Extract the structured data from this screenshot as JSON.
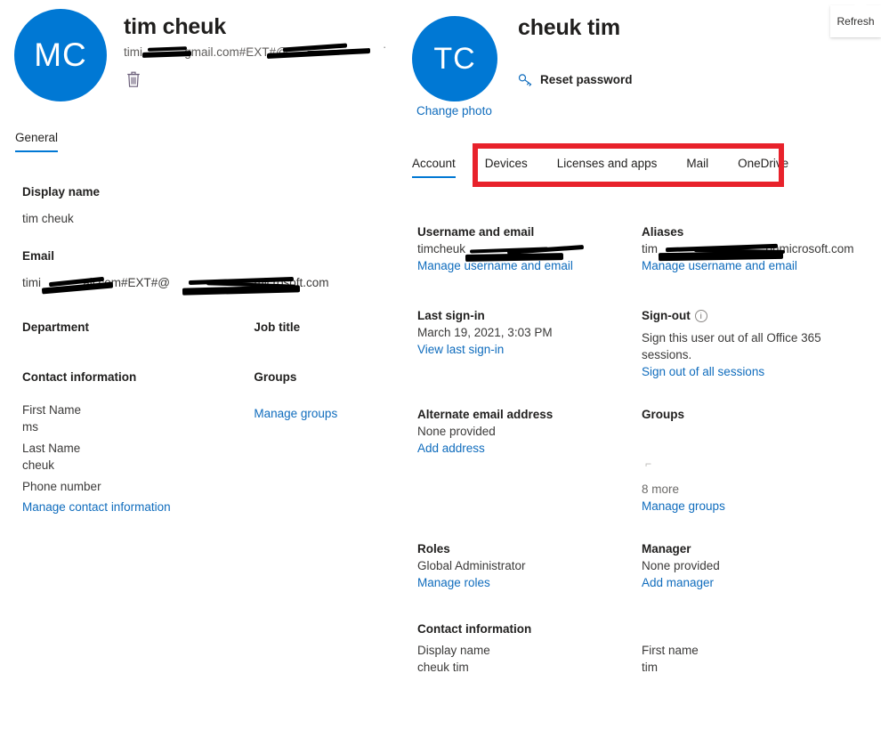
{
  "left_panel": {
    "avatar_initials": "MC",
    "avatar_color": "#0078d4",
    "display_name": "tim cheuk",
    "email_header_prefix": "timi",
    "email_header_mid": "gmail.com#EXT#@",
    "delete_icon": "trash-icon",
    "tabs": [
      {
        "label": "General",
        "selected": true
      }
    ],
    "sections": {
      "display_name": {
        "header": "Display name",
        "value": "tim cheuk"
      },
      "email": {
        "header": "Email",
        "value_prefix": "timi",
        "value_mid": "ail.com#EXT#@",
        "value_suffix": "microsoft.com"
      },
      "department": {
        "header": "Department",
        "value": ""
      },
      "job_title": {
        "header": "Job title",
        "value": ""
      },
      "contact_information": {
        "header": "Contact information",
        "fields": [
          {
            "label": "First Name",
            "value": "ms"
          },
          {
            "label": "Last Name",
            "value": "cheuk"
          },
          {
            "label": "Phone number",
            "value": ""
          }
        ],
        "link": "Manage contact information"
      },
      "groups": {
        "header": "Groups",
        "link": "Manage groups"
      }
    }
  },
  "right_panel": {
    "avatar_initials": "TC",
    "avatar_color": "#0078d4",
    "change_photo": "Change photo",
    "display_name": "cheuk tim",
    "reset_password": {
      "label": "Reset password",
      "icon": "key-icon"
    },
    "tabs": [
      {
        "label": "Account",
        "selected": true
      },
      {
        "label": "Devices",
        "selected": false
      },
      {
        "label": "Licenses and apps",
        "selected": false
      },
      {
        "label": "Mail",
        "selected": false
      },
      {
        "label": "OneDrive",
        "selected": false
      }
    ],
    "highlight_color": "#e8222b",
    "sections": {
      "username_and_email": {
        "header": "Username and email",
        "value_prefix": "timcheuk",
        "link": "Manage username and email"
      },
      "aliases": {
        "header": "Aliases",
        "value_prefix": "tim",
        "value_suffix": "onmicrosoft.com",
        "link": "Manage username and email"
      },
      "last_sign_in": {
        "header": "Last sign-in",
        "value": "March 19, 2021, 3:03 PM",
        "link": "View last sign-in"
      },
      "sign_out": {
        "header": "Sign-out",
        "info_icon": "info-circle-icon",
        "value": "Sign this user out of all Office 365 sessions.",
        "link": "Sign out of all sessions"
      },
      "alternate_email": {
        "header": "Alternate email address",
        "value": "None provided",
        "link": "Add address"
      },
      "groups": {
        "header": "Groups",
        "items": [
          "",
          "",
          ""
        ],
        "more": "8 more",
        "link": "Manage groups"
      },
      "roles": {
        "header": "Roles",
        "value": "Global Administrator",
        "link": "Manage roles"
      },
      "manager": {
        "header": "Manager",
        "value": "None provided",
        "link": "Add manager"
      },
      "contact_information": {
        "header": "Contact information",
        "display_name_label": "Display name",
        "display_name_value": "cheuk tim",
        "first_name_label": "First name",
        "first_name_value": "tim"
      }
    }
  },
  "tooltip": {
    "label": "Refresh"
  }
}
